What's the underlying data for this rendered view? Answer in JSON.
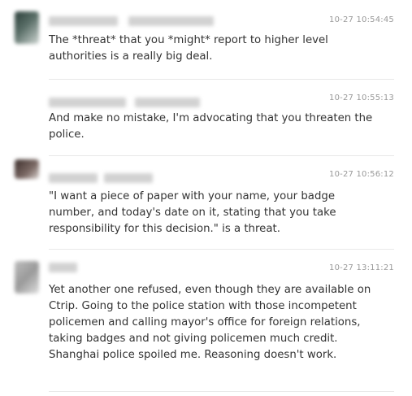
{
  "comments": [
    {
      "timestamp": "10-27 10:54:45",
      "text": "The *threat* that you *might* report to higher level authorities is a really big deal."
    },
    {
      "timestamp": "10-27 10:55:13",
      "text": "And make no mistake, I'm advocating that you threaten the police."
    },
    {
      "timestamp": "10-27 10:56:12",
      "text": "\"I want a piece of paper with your name, your badge number, and today's date on it, stating that you take responsibility for this decision.\" is a threat."
    },
    {
      "timestamp": "10-27 13:11:21",
      "text": "Yet another one refused, even though they are available on Ctrip. Going to the police station with those incompetent policemen and calling mayor's office for foreign relations, taking badges and not giving policemen much credit. Shanghai police spoiled me. Reasoning doesn't work."
    }
  ]
}
